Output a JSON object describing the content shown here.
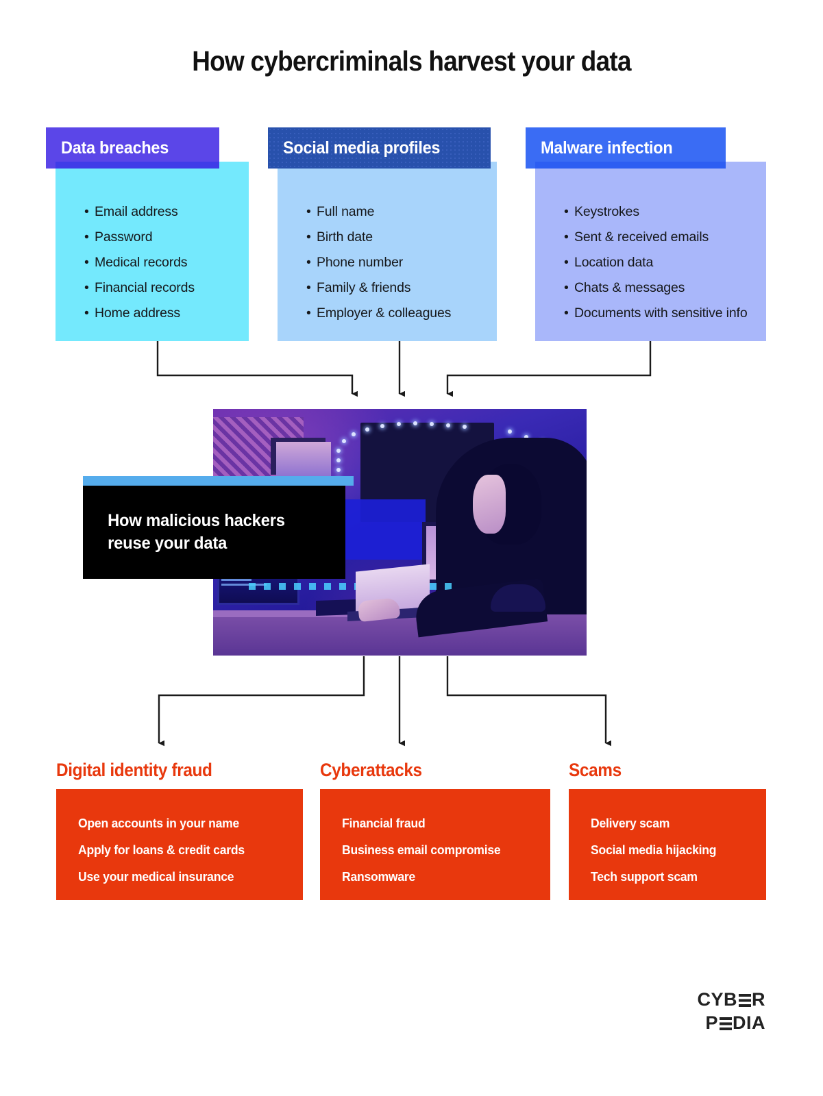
{
  "title": "How cybercriminals harvest your data",
  "colors": {
    "purple": "#5B46E8",
    "cyan": "#74E9FD",
    "navy": "#2851AC",
    "light_blue": "#A8D4FB",
    "blue": "#3A6CF4",
    "periwinkle": "#A9B7FA",
    "red": "#E8380D",
    "black": "#000000",
    "strip_blue": "#55ACEC"
  },
  "sources": [
    {
      "heading": "Data breaches",
      "items": [
        "Email address",
        "Password",
        "Medical records",
        "Financial records",
        "Home address"
      ]
    },
    {
      "heading": "Social media profiles",
      "items": [
        "Full name",
        "Birth date",
        "Phone number",
        "Family & friends",
        "Employer & colleagues"
      ]
    },
    {
      "heading": "Malware infection",
      "items": [
        "Keystrokes",
        "Sent & received emails",
        "Location data",
        "Chats & messages",
        "Documents with sensitive info"
      ]
    }
  ],
  "hero": {
    "caption_line1": "How malicious hackers",
    "caption_line2": "reuse your data",
    "photo_alt": "hooded hacker typing on a laptop in a dark room lit with blue and purple light"
  },
  "outcomes": [
    {
      "title": "Digital identity fraud",
      "items": [
        "Open accounts in your name",
        "Apply for loans & credit cards",
        "Use your medical insurance"
      ]
    },
    {
      "title": "Cyberattacks",
      "items": [
        "Financial fraud",
        "Business email compromise",
        "Ransomware"
      ]
    },
    {
      "title": "Scams",
      "items": [
        "Delivery scam",
        "Social media hijacking",
        "Tech support scam"
      ]
    }
  ],
  "logo": {
    "line1_a": "CYB",
    "line1_b": "R",
    "line2_a": "P",
    "line2_b": "DIA"
  }
}
